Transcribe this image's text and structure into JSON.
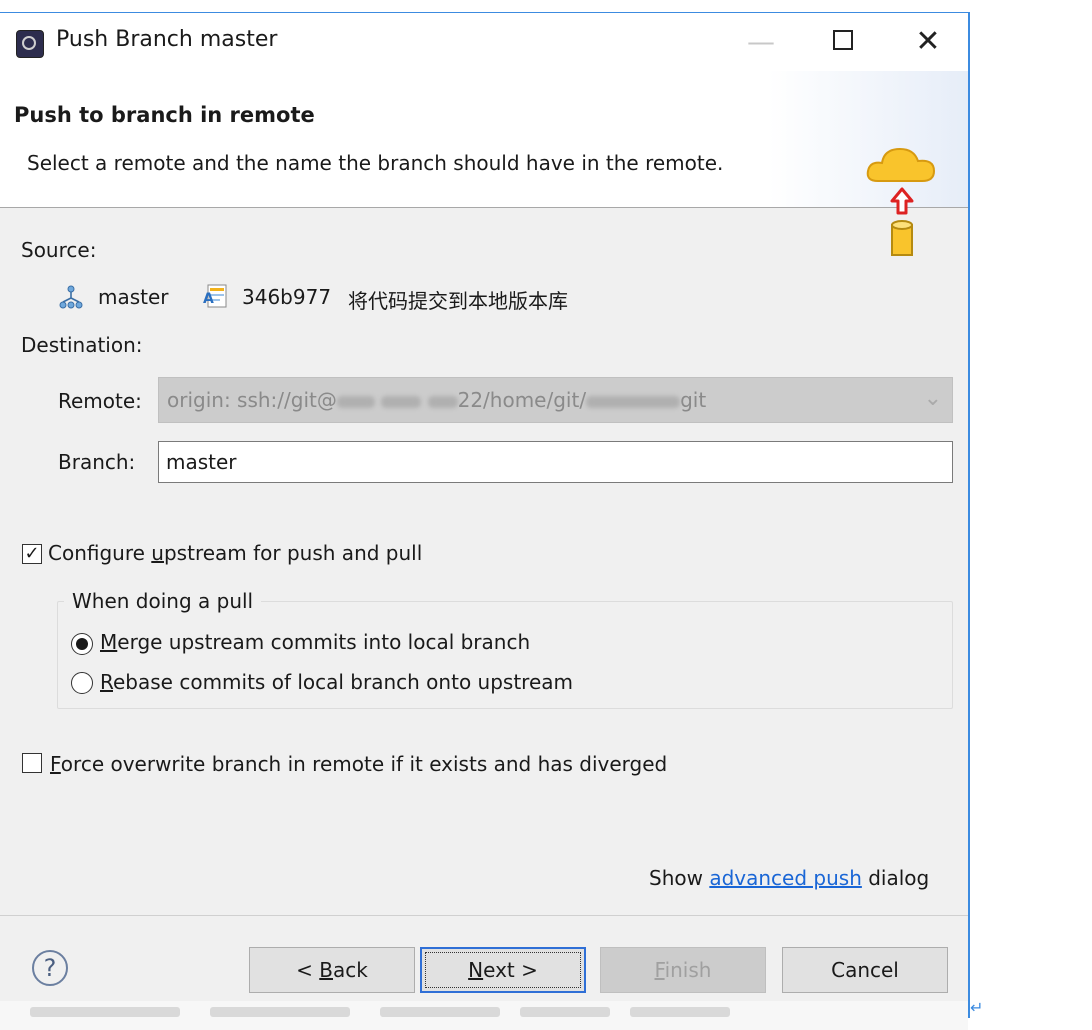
{
  "window": {
    "title": "Push Branch master",
    "controls": {
      "minimize": "—",
      "maximize": "",
      "close": "✕"
    }
  },
  "header": {
    "title": "Push to branch in remote",
    "description": "Select a remote and the name the branch should have in the remote."
  },
  "source": {
    "label": "Source:",
    "branch": "master",
    "commit_hash": "346b977",
    "commit_message": "将代码提交到本地版本库"
  },
  "destination": {
    "label": "Destination:",
    "remote_label": "Remote:",
    "remote_prefix": "origin: ssh://git@",
    "remote_middle": "22/home/git/",
    "remote_suffix": "git",
    "branch_label": "Branch:",
    "branch_value": "master"
  },
  "upstream": {
    "checked": true,
    "label_before": "Configure ",
    "label_mnemonic": "u",
    "label_after": "pstream for push and pull",
    "group_title": "When doing a pull",
    "merge_mnemonic": "M",
    "merge_rest": "erge upstream commits into local branch",
    "rebase_mnemonic": "R",
    "rebase_rest": "ebase commits of local branch onto upstream",
    "selected": "merge"
  },
  "force": {
    "checked": false,
    "mnemonic": "F",
    "rest": "orce overwrite branch in remote if it exists and has diverged"
  },
  "advanced": {
    "before": "Show ",
    "link": "advanced push",
    "after": " dialog"
  },
  "buttons": {
    "help": "?",
    "back_prefix": "< ",
    "back_mnemonic": "B",
    "back_rest": "ack",
    "next_mnemonic": "N",
    "next_rest": "ext >",
    "finish_mnemonic": "F",
    "finish_rest": "inish",
    "cancel": "Cancel"
  },
  "colors": {
    "accent": "#3c8be0",
    "link": "#1a66d6",
    "dialog_bg": "#f0f0f0"
  }
}
